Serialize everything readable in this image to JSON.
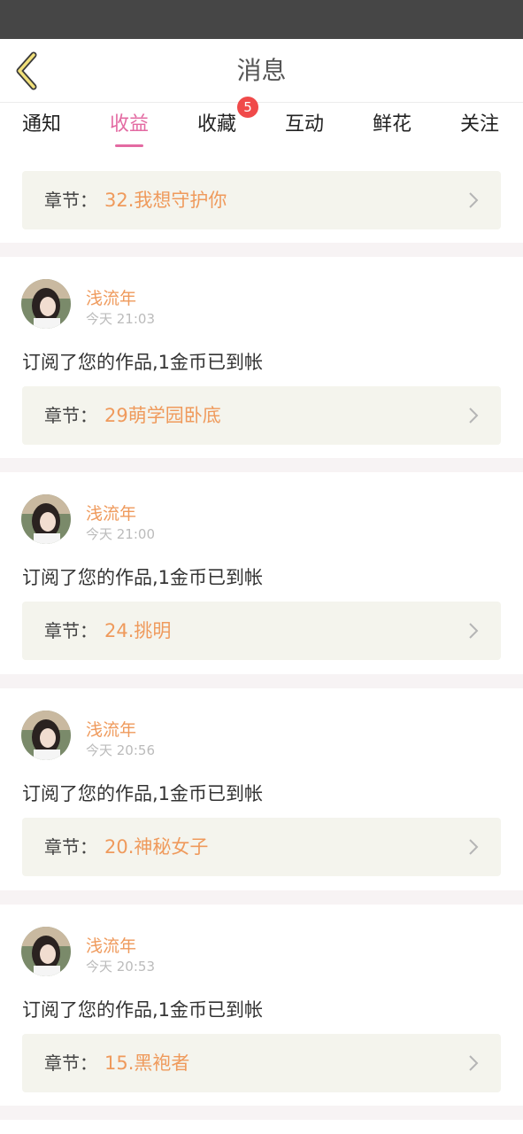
{
  "header": {
    "title": "消息"
  },
  "tabs": [
    {
      "label": "通知",
      "active": false
    },
    {
      "label": "收益",
      "active": true
    },
    {
      "label": "收藏",
      "active": false,
      "badge": "5"
    },
    {
      "label": "互动",
      "active": false
    },
    {
      "label": "鲜花",
      "active": false
    },
    {
      "label": "关注",
      "active": false
    }
  ],
  "chapter_prefix": "章节：",
  "top_chapter": {
    "title": "32.我想守护你"
  },
  "items": [
    {
      "user": "浅流年",
      "time": "今天 21:03",
      "message": "订阅了您的作品,1金币已到帐",
      "chapter": "29萌学园卧底"
    },
    {
      "user": "浅流年",
      "time": "今天 21:00",
      "message": "订阅了您的作品,1金币已到帐",
      "chapter": "24.挑明"
    },
    {
      "user": "浅流年",
      "time": "今天 20:56",
      "message": "订阅了您的作品,1金币已到帐",
      "chapter": "20.神秘女子"
    },
    {
      "user": "浅流年",
      "time": "今天 20:53",
      "message": "订阅了您的作品,1金币已到帐",
      "chapter": "15.黑袍者"
    }
  ],
  "colors": {
    "accent": "#e36aa2",
    "orange": "#ef9a5c",
    "badge": "#f04a4a",
    "status_bar": "#464646"
  },
  "icons": {
    "back": "chevron-left-icon",
    "row_arrow": "chevron-right-icon"
  }
}
